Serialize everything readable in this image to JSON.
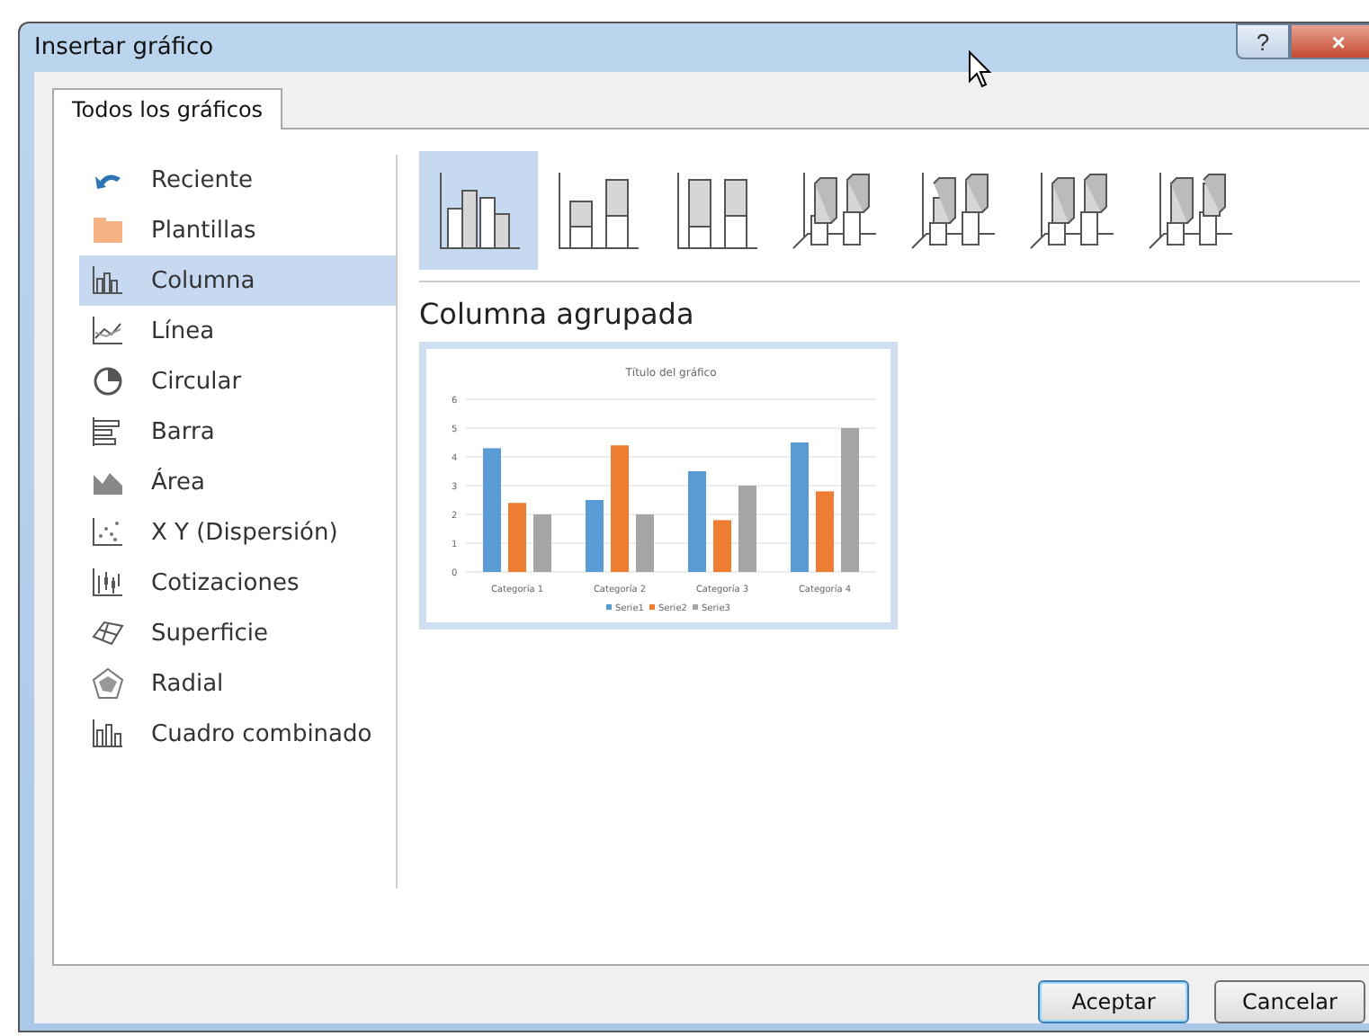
{
  "window": {
    "title": "Insertar gráfico",
    "help": "?",
    "close": "×"
  },
  "tabs": [
    {
      "label": "Todos los gráficos",
      "selected": true
    }
  ],
  "sidebar": {
    "items": [
      {
        "label": "Reciente",
        "kind": "recent",
        "selected": false
      },
      {
        "label": "Plantillas",
        "kind": "folder",
        "selected": false
      },
      {
        "label": "Columna",
        "kind": "column",
        "selected": true
      },
      {
        "label": "Línea",
        "kind": "line",
        "selected": false
      },
      {
        "label": "Circular",
        "kind": "pie",
        "selected": false
      },
      {
        "label": "Barra",
        "kind": "bar",
        "selected": false
      },
      {
        "label": "Área",
        "kind": "area",
        "selected": false
      },
      {
        "label": "X Y (Dispersión)",
        "kind": "scatter",
        "selected": false
      },
      {
        "label": "Cotizaciones",
        "kind": "stock",
        "selected": false
      },
      {
        "label": "Superficie",
        "kind": "surface",
        "selected": false
      },
      {
        "label": "Radial",
        "kind": "radar",
        "selected": false
      },
      {
        "label": "Cuadro combinado",
        "kind": "combo",
        "selected": false
      }
    ]
  },
  "subtypes": [
    {
      "kind": "clustered",
      "selected": true
    },
    {
      "kind": "stacked",
      "selected": false
    },
    {
      "kind": "stacked100",
      "selected": false
    },
    {
      "kind": "clustered3d",
      "selected": false
    },
    {
      "kind": "stacked3d",
      "selected": false
    },
    {
      "kind": "stacked100_3d",
      "selected": false
    },
    {
      "kind": "column3d",
      "selected": false
    }
  ],
  "preview": {
    "heading": "Columna agrupada",
    "chart_data": {
      "type": "bar",
      "title": "Título del gráfico",
      "categories": [
        "Categoría 1",
        "Categoría 2",
        "Categoría 3",
        "Categoría 4"
      ],
      "series": [
        {
          "name": "Serie1",
          "color": "#5b9bd5",
          "values": [
            4.3,
            2.5,
            3.5,
            4.5
          ]
        },
        {
          "name": "Serie2",
          "color": "#ed7d31",
          "values": [
            2.4,
            4.4,
            1.8,
            2.8
          ]
        },
        {
          "name": "Serie3",
          "color": "#a5a5a5",
          "values": [
            2,
            2,
            3,
            5
          ]
        }
      ],
      "ylim": [
        0,
        6
      ],
      "yticks": [
        0,
        1,
        2,
        3,
        4,
        5,
        6
      ],
      "grid": true,
      "legend": true
    }
  },
  "buttons": [
    {
      "label": "Aceptar",
      "kind": "default"
    },
    {
      "label": "Cancelar",
      "kind": "normal"
    }
  ]
}
